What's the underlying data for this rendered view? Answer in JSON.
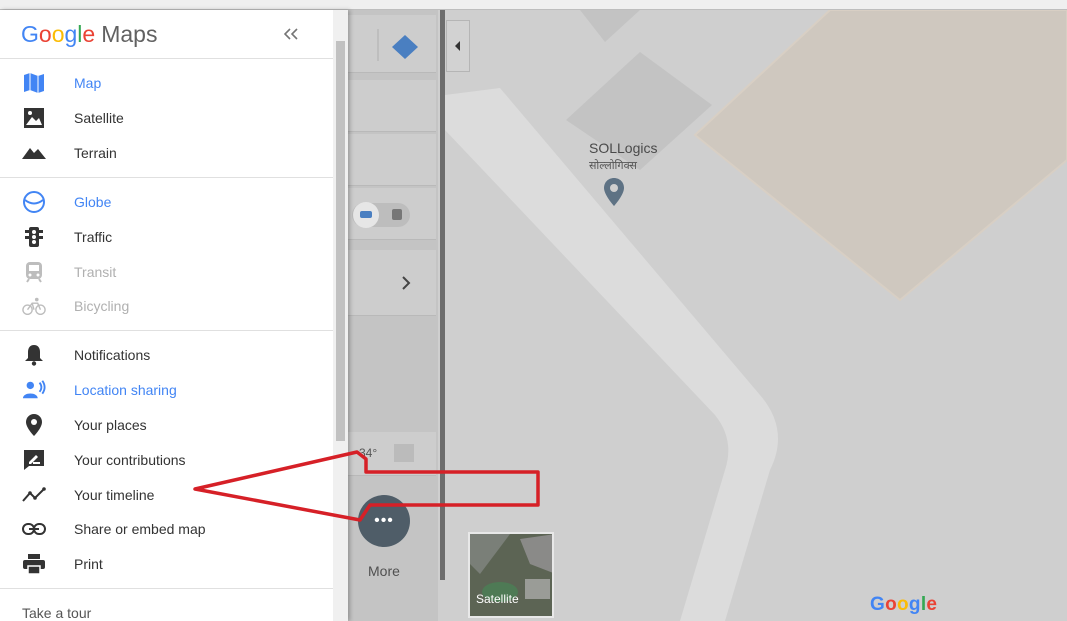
{
  "map": {
    "poi_name": "SOLLogics",
    "poi_subname": "सोल्लोगिक्स",
    "google_logo": [
      "G",
      "o",
      "o",
      "g",
      "l",
      "e"
    ],
    "google_colors": [
      "#4285f4",
      "#ea4335",
      "#fbbc05",
      "#4285f4",
      "#34a853",
      "#ea4335"
    ],
    "satellite_label": "Satellite",
    "more_label": "More",
    "temperature": "34°"
  },
  "sidebar": {
    "brand_letters": [
      "G",
      "o",
      "o",
      "g",
      "l",
      "e"
    ],
    "brand_product": "Maps",
    "layers": [
      {
        "label": "Map",
        "icon": "map-icon",
        "state": "active"
      },
      {
        "label": "Satellite",
        "icon": "satellite-icon",
        "state": "normal"
      },
      {
        "label": "Terrain",
        "icon": "terrain-icon",
        "state": "normal"
      }
    ],
    "overlays": [
      {
        "label": "Globe",
        "icon": "globe-icon",
        "state": "active"
      },
      {
        "label": "Traffic",
        "icon": "traffic-icon",
        "state": "normal"
      },
      {
        "label": "Transit",
        "icon": "transit-icon",
        "state": "disabled"
      },
      {
        "label": "Bicycling",
        "icon": "bicycle-icon",
        "state": "disabled"
      }
    ],
    "actions": [
      {
        "label": "Notifications",
        "icon": "bell-icon",
        "state": "normal"
      },
      {
        "label": "Location sharing",
        "icon": "location-sharing-icon",
        "state": "active"
      },
      {
        "label": "Your places",
        "icon": "pin-icon",
        "state": "normal"
      },
      {
        "label": "Your contributions",
        "icon": "contributions-icon",
        "state": "normal"
      },
      {
        "label": "Your timeline",
        "icon": "timeline-icon",
        "state": "normal"
      },
      {
        "label": "Share or embed map",
        "icon": "link-icon",
        "state": "normal"
      },
      {
        "label": "Print",
        "icon": "print-icon",
        "state": "normal"
      }
    ],
    "footer": "Take a tour"
  },
  "colors": {
    "accent": "#4285f4",
    "annotation_arrow": "#d62027"
  }
}
